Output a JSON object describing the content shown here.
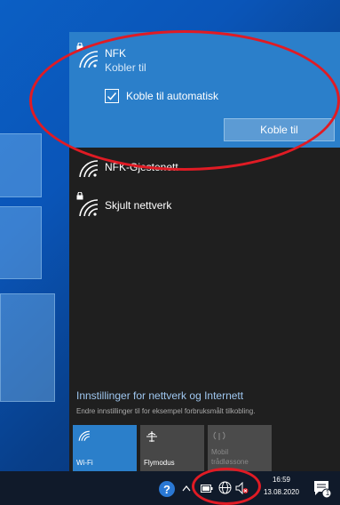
{
  "selected_network": {
    "name": "NFK",
    "status": "Kobler til",
    "auto_connect_label": "Koble til automatisk",
    "auto_connect_checked": true,
    "connect_button_label": "Koble til"
  },
  "networks": [
    {
      "name": "NFK-Gjestenett",
      "secured": false
    },
    {
      "name": "Skjult nettverk",
      "secured": true
    }
  ],
  "settings": {
    "link_label": "Innstillinger for nettverk og Internett",
    "description": "Endre innstillinger til for eksempel forbruksmålt tilkobling."
  },
  "quick_actions": [
    {
      "label": "Wi-Fi",
      "icon": "wifi-icon",
      "active": true
    },
    {
      "label": "Flymodus",
      "icon": "airplane-icon",
      "active": false
    },
    {
      "label": "Mobil",
      "label2": "trådløssone",
      "icon": "hotspot-icon",
      "active": false,
      "disabled": true
    }
  ],
  "taskbar": {
    "time": "16:59",
    "date": "13.08.2020",
    "notification_count": "1",
    "icons": [
      "help-icon",
      "chevron-up-icon",
      "battery-icon",
      "globe-network-icon",
      "volume-muted-icon",
      "action-center-icon"
    ]
  },
  "colors": {
    "accent": "#2b7fca",
    "flyout_bg": "#1f1f1f",
    "annotation": "#e01b24"
  }
}
